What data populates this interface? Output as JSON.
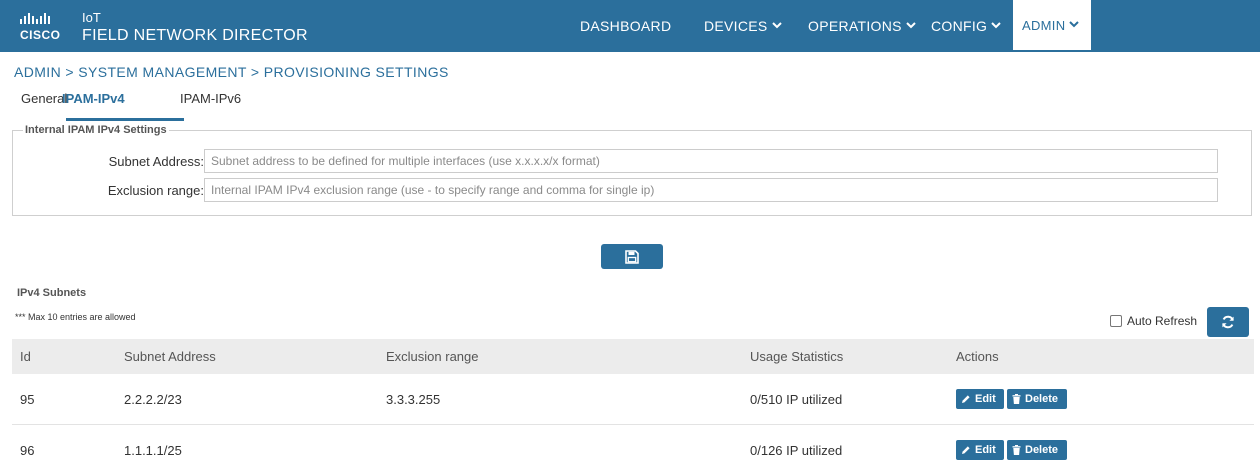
{
  "header": {
    "brand": {
      "logo_word": "CISCO",
      "product_line": "IoT",
      "product_name": "FIELD NETWORK DIRECTOR"
    },
    "nav": [
      {
        "label": "DASHBOARD",
        "has_dropdown": false
      },
      {
        "label": "DEVICES",
        "has_dropdown": true
      },
      {
        "label": "OPERATIONS",
        "has_dropdown": true
      },
      {
        "label": "CONFIG",
        "has_dropdown": true
      },
      {
        "label": "ADMIN",
        "has_dropdown": true,
        "active": true
      }
    ]
  },
  "breadcrumb": "ADMIN > SYSTEM MANAGEMENT > PROVISIONING SETTINGS",
  "tabs": [
    {
      "label": "General",
      "active": false
    },
    {
      "label": "IPAM-IPv4",
      "active": true
    },
    {
      "label": "IPAM-IPv6",
      "active": false
    }
  ],
  "settings": {
    "legend": "Internal IPAM IPv4 Settings",
    "subnet": {
      "label": "Subnet Address:",
      "value": "",
      "placeholder": "Subnet address to be defined for multiple interfaces (use x.x.x.x/x format)"
    },
    "exclusion": {
      "label": "Exclusion range:",
      "value": "",
      "placeholder": "Internal IPAM IPv4 exclusion range (use - to specify range and comma for single ip)"
    }
  },
  "save_icon": "floppy-disk-icon",
  "subnets": {
    "title": "IPv4 Subnets",
    "note": "*** Max 10 entries are allowed",
    "auto_refresh_label": "Auto Refresh",
    "auto_refresh_checked": false,
    "refresh_icon": "refresh-icon",
    "columns": [
      "Id",
      "Subnet Address",
      "Exclusion range",
      "Usage Statistics",
      "Actions"
    ],
    "rows": [
      {
        "id": "95",
        "subnet": "2.2.2.2/23",
        "exclusion": "3.3.3.255",
        "usage": "0/510 IP utilized"
      },
      {
        "id": "96",
        "subnet": "1.1.1.1/25",
        "exclusion": "",
        "usage": "0/126 IP utilized"
      }
    ],
    "edit_label": "Edit",
    "delete_label": "Delete"
  },
  "colors": {
    "primary": "#2b6f9c",
    "header_bg": "#2b6f9c",
    "table_header_bg": "#ececec"
  }
}
